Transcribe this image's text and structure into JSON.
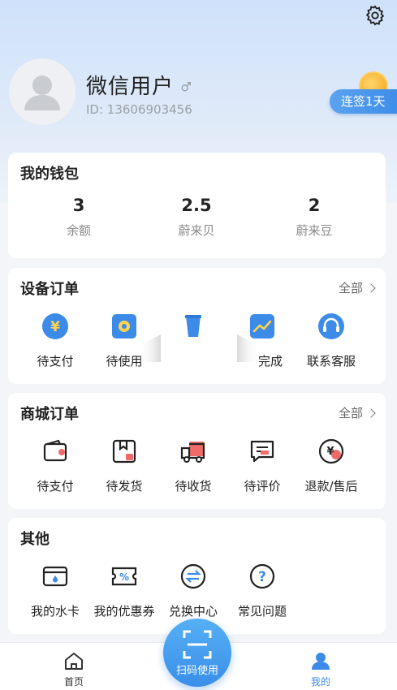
{
  "profile": {
    "name": "微信用户",
    "id_text": "ID: 13606903456",
    "checkin_label": "连签1天"
  },
  "wallet": {
    "title": "我的钱包",
    "items": [
      {
        "value": "3",
        "label": "余额"
      },
      {
        "value": "2.5",
        "label": "蔚来贝"
      },
      {
        "value": "2",
        "label": "蔚来豆"
      }
    ]
  },
  "device_orders": {
    "title": "设备订单",
    "more_label": "全部",
    "items": [
      {
        "label": "待支付",
        "icon": "yen-icon"
      },
      {
        "label": "待使用",
        "icon": "flower-icon"
      },
      {
        "label": "",
        "icon": "cup-icon"
      },
      {
        "label": "完成",
        "icon": "chart-icon"
      },
      {
        "label": "联系客服",
        "icon": "headset-icon"
      }
    ]
  },
  "mall_orders": {
    "title": "商城订单",
    "more_label": "全部",
    "items": [
      {
        "label": "待支付",
        "icon": "wallet-icon"
      },
      {
        "label": "待发货",
        "icon": "box-icon"
      },
      {
        "label": "待收货",
        "icon": "truck-icon"
      },
      {
        "label": "待评价",
        "icon": "comment-icon"
      },
      {
        "label": "退款/售后",
        "icon": "refund-icon"
      }
    ]
  },
  "others": {
    "title": "其他",
    "items": [
      {
        "label": "我的水卡",
        "icon": "card-icon"
      },
      {
        "label": "我的优惠券",
        "icon": "coupon-icon"
      },
      {
        "label": "兑换中心",
        "icon": "exchange-icon"
      },
      {
        "label": "常见问题",
        "icon": "question-icon"
      }
    ]
  },
  "tabbar": {
    "home_label": "首页",
    "scan_label": "扫码使用",
    "mine_label": "我的"
  },
  "colors": {
    "accent": "#3d8be8",
    "icon_red": "#f06a6a",
    "active_tab": "#3d8be8"
  }
}
